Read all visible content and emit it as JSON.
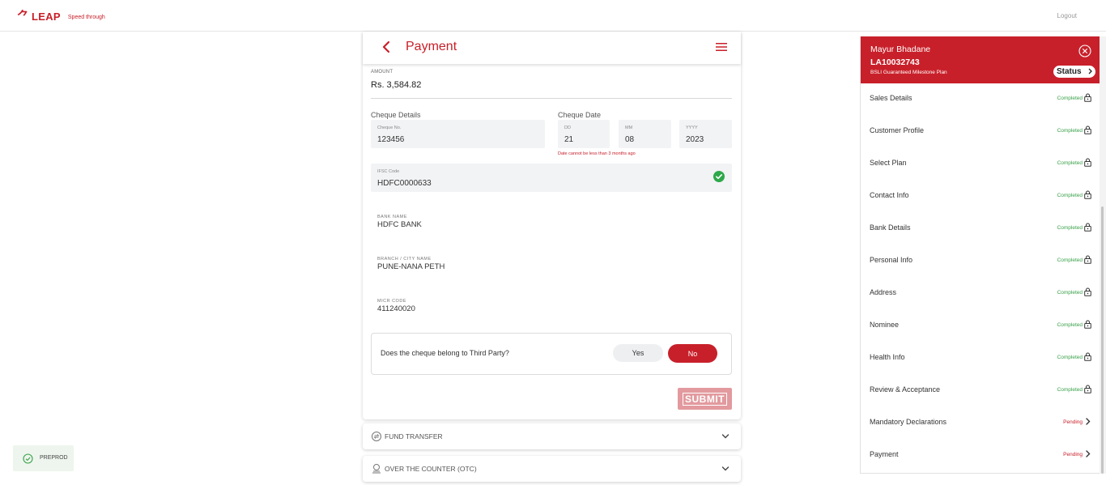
{
  "header": {
    "logo_text": "LEAP",
    "tagline": "Speed through",
    "logout": "Logout"
  },
  "payment": {
    "title": "Payment",
    "amount_label": "AMOUNT",
    "amount_value": "Rs. 3,584.82",
    "cheque_details_label": "Cheque Details",
    "cheque_date_label": "Cheque Date",
    "cheque_no_label": "Cheque No.",
    "cheque_no_value": "123456",
    "dd_label": "DD",
    "dd_value": "21",
    "mm_label": "MM",
    "mm_value": "08",
    "yyyy_label": "YYYY",
    "yyyy_value": "2023",
    "date_error": "Date cannot be less than 3 months ago",
    "ifsc_label": "IFSC Code",
    "ifsc_value": "HDFC0000633",
    "bank_name_label": "BANK NAME",
    "bank_name_value": "HDFC BANK",
    "branch_label": "BRANCH / CITY NAME",
    "branch_value": "PUNE-NANA PETH",
    "micr_label": "MICR CODE",
    "micr_value": "411240020",
    "third_party_question": "Does the cheque belong to Third Party?",
    "yes_label": "Yes",
    "no_label": "No",
    "submit_label": "SUBMIT"
  },
  "accordions": {
    "fund_transfer": "FUND TRANSFER",
    "otc": "OVER THE COUNTER (OTC)"
  },
  "env_badge": "PREPROD",
  "panel": {
    "name": "Mayur Bhadane",
    "application_id": "LA10032743",
    "plan": "BSLI Guaranteed Milestone Plan",
    "status_button": "Status",
    "steps": [
      {
        "label": "Sales Details",
        "status": "Completed"
      },
      {
        "label": "Customer Profile",
        "status": "Completed"
      },
      {
        "label": "Select Plan",
        "status": "Completed"
      },
      {
        "label": "Contact Info",
        "status": "Completed"
      },
      {
        "label": "Bank Details",
        "status": "Completed"
      },
      {
        "label": "Personal Info",
        "status": "Completed"
      },
      {
        "label": "Address",
        "status": "Completed"
      },
      {
        "label": "Nominee",
        "status": "Completed"
      },
      {
        "label": "Health Info",
        "status": "Completed"
      },
      {
        "label": "Review & Acceptance",
        "status": "Completed"
      },
      {
        "label": "Mandatory Declarations",
        "status": "Pending"
      },
      {
        "label": "Payment",
        "status": "Pending"
      }
    ]
  },
  "colors": {
    "brand": "#c8202a",
    "completed": "#3aa14a",
    "field_bg": "#f2f3f5"
  }
}
